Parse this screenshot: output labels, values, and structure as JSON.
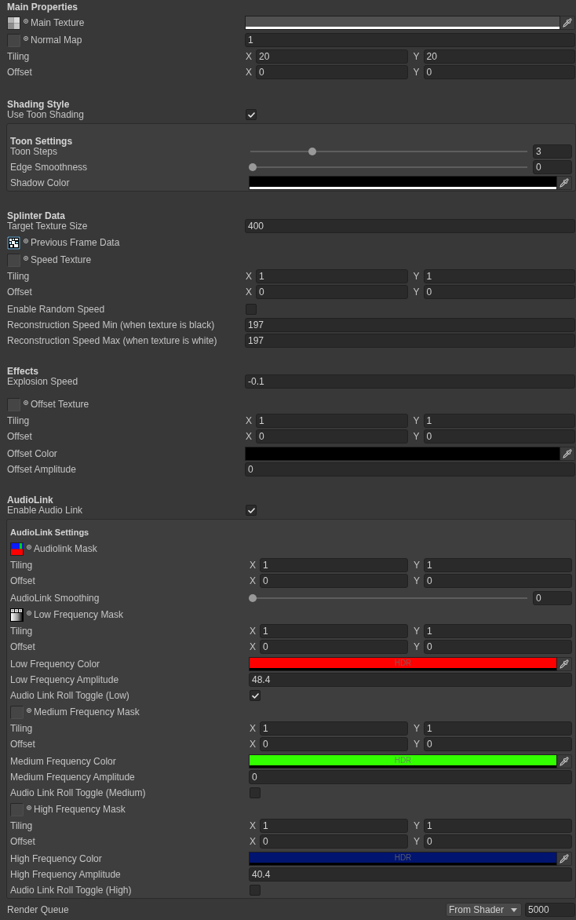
{
  "sections": [
    {
      "title": "Main Properties",
      "rows": [
        {
          "kind": "texture",
          "label": "Main Texture",
          "thumbnail": {
            "kind": "checker"
          },
          "value": {
            "kind": "color",
            "color": "#505050",
            "level": 1
          }
        },
        {
          "kind": "texture",
          "label": "Normal Map",
          "thumbnail": {
            "kind": "empty"
          },
          "value": {
            "kind": "number",
            "value": "1"
          }
        },
        {
          "kind": "vector",
          "label": "Tiling",
          "components": [
            {
              "axis": "X",
              "value": "20"
            },
            {
              "axis": "Y",
              "value": "20"
            }
          ]
        },
        {
          "kind": "vector",
          "label": "Offset",
          "components": [
            {
              "axis": "X",
              "value": "0"
            },
            {
              "axis": "Y",
              "value": "0"
            }
          ]
        }
      ]
    },
    {
      "title": "Shading Style",
      "rows": [
        {
          "kind": "checkbox",
          "label": "Use Toon Shading",
          "checked": true
        },
        {
          "kind": "panel",
          "sections": [
            {
              "title": "Toon Settings",
              "rows": [
                {
                  "kind": "slider",
                  "label": "Toon Steps",
                  "level": 0.22,
                  "value": "3"
                },
                {
                  "kind": "slider",
                  "label": "Edge Smoothness",
                  "level": 0,
                  "value": "0"
                },
                {
                  "kind": "color",
                  "label": "Shadow Color",
                  "color": "#000000",
                  "level": 1
                }
              ]
            }
          ]
        }
      ]
    },
    {
      "title": "Splinter Data",
      "rows": [
        {
          "kind": "number",
          "label": "Target Texture Size",
          "value": "400"
        },
        {
          "kind": "texture",
          "label": "Previous Frame Data",
          "thumbnail": {
            "kind": "pixels"
          }
        },
        {
          "kind": "texture",
          "label": "Speed Texture",
          "thumbnail": {
            "kind": "empty"
          }
        },
        {
          "kind": "vector",
          "label": "Tiling",
          "components": [
            {
              "axis": "X",
              "value": "1"
            },
            {
              "axis": "Y",
              "value": "1"
            }
          ]
        },
        {
          "kind": "vector",
          "label": "Offset",
          "components": [
            {
              "axis": "X",
              "value": "0"
            },
            {
              "axis": "Y",
              "value": "0"
            }
          ]
        },
        {
          "kind": "checkbox",
          "label": "Enable Random Speed",
          "checked": false
        },
        {
          "kind": "number",
          "label": "Reconstruction Speed Min (when texture is black)",
          "value": "197"
        },
        {
          "kind": "number",
          "label": "Reconstruction Speed Max (when texture is white)",
          "value": "197"
        }
      ]
    },
    {
      "title": "Effects",
      "rows": [
        {
          "kind": "number",
          "label": "Explosion Speed",
          "value": "-0.1"
        },
        {
          "kind": "texture",
          "label": "Offset Texture",
          "thumbnail": {
            "kind": "empty"
          }
        },
        {
          "kind": "vector",
          "label": "Tiling",
          "components": [
            {
              "axis": "X",
              "value": "1"
            },
            {
              "axis": "Y",
              "value": "1"
            }
          ]
        },
        {
          "kind": "vector",
          "label": "Offset",
          "components": [
            {
              "axis": "X",
              "value": "0"
            },
            {
              "axis": "Y",
              "value": "0"
            }
          ]
        },
        {
          "kind": "color",
          "label": "Offset Color",
          "color": "#000000",
          "level": 0
        },
        {
          "kind": "number",
          "label": "Offset Amplitude",
          "value": "0"
        }
      ]
    },
    {
      "title": "AudioLink",
      "rows": [
        {
          "kind": "checkbox",
          "label": "Enable Audio Link",
          "checked": true
        },
        {
          "kind": "panel",
          "title": "AudioLink Settings",
          "rows": [
            {
              "kind": "texture",
              "label": "Audiolink Mask",
              "thumbnail": {
                "kind": "blocks"
              }
            },
            {
              "kind": "vector",
              "label": "Tiling",
              "components": [
                {
                  "axis": "X",
                  "value": "1"
                },
                {
                  "axis": "Y",
                  "value": "1"
                }
              ]
            },
            {
              "kind": "vector",
              "label": "Offset",
              "components": [
                {
                  "axis": "X",
                  "value": "0"
                },
                {
                  "axis": "Y",
                  "value": "0"
                }
              ]
            },
            {
              "kind": "slider",
              "label": "AudioLink Smoothing",
              "level": 0,
              "value": "0"
            },
            {
              "kind": "texture",
              "label": "Low Frequency Mask",
              "thumbnail": {
                "kind": "stripes"
              }
            },
            {
              "kind": "vector",
              "label": "Tiling",
              "components": [
                {
                  "axis": "X",
                  "value": "1"
                },
                {
                  "axis": "Y",
                  "value": "1"
                }
              ]
            },
            {
              "kind": "vector",
              "label": "Offset",
              "components": [
                {
                  "axis": "X",
                  "value": "0"
                },
                {
                  "axis": "Y",
                  "value": "0"
                }
              ]
            },
            {
              "kind": "color",
              "label": "Low Frequency Color",
              "color": "#ff0000",
              "level": 0,
              "badge": "HDR"
            },
            {
              "kind": "number",
              "label": "Low Frequency Amplitude",
              "value": "48.4"
            },
            {
              "kind": "checkbox",
              "label": "Audio Link Roll Toggle (Low)",
              "checked": true
            },
            {
              "kind": "texture",
              "label": "Medium Frequency Mask",
              "thumbnail": {
                "kind": "empty"
              }
            },
            {
              "kind": "vector",
              "label": "Tiling",
              "components": [
                {
                  "axis": "X",
                  "value": "1"
                },
                {
                  "axis": "Y",
                  "value": "1"
                }
              ]
            },
            {
              "kind": "vector",
              "label": "Offset",
              "components": [
                {
                  "axis": "X",
                  "value": "0"
                },
                {
                  "axis": "Y",
                  "value": "0"
                }
              ]
            },
            {
              "kind": "color",
              "label": "Medium Frequency Color",
              "color": "#33ff00",
              "level": 0,
              "badge": "HDR"
            },
            {
              "kind": "number",
              "label": "Medium Frequency Amplitude",
              "value": "0"
            },
            {
              "kind": "checkbox",
              "label": "Audio Link Roll Toggle (Medium)",
              "checked": false
            },
            {
              "kind": "texture",
              "label": "High Frequency Mask",
              "thumbnail": {
                "kind": "empty"
              }
            },
            {
              "kind": "vector",
              "label": "Tiling",
              "components": [
                {
                  "axis": "X",
                  "value": "1"
                },
                {
                  "axis": "Y",
                  "value": "1"
                }
              ]
            },
            {
              "kind": "vector",
              "label": "Offset",
              "components": [
                {
                  "axis": "X",
                  "value": "0"
                },
                {
                  "axis": "Y",
                  "value": "0"
                }
              ]
            },
            {
              "kind": "color",
              "label": "High Frequency Color",
              "color": "#01146f",
              "level": 0,
              "badge": "HDR"
            },
            {
              "kind": "number",
              "label": "High Frequency Amplitude",
              "value": "40.4"
            },
            {
              "kind": "checkbox",
              "label": "Audio Link Roll Toggle (High)",
              "checked": false
            }
          ]
        }
      ]
    }
  ],
  "render_queue": {
    "label": "Render Queue",
    "mode": "From Shader",
    "value": "5000"
  }
}
